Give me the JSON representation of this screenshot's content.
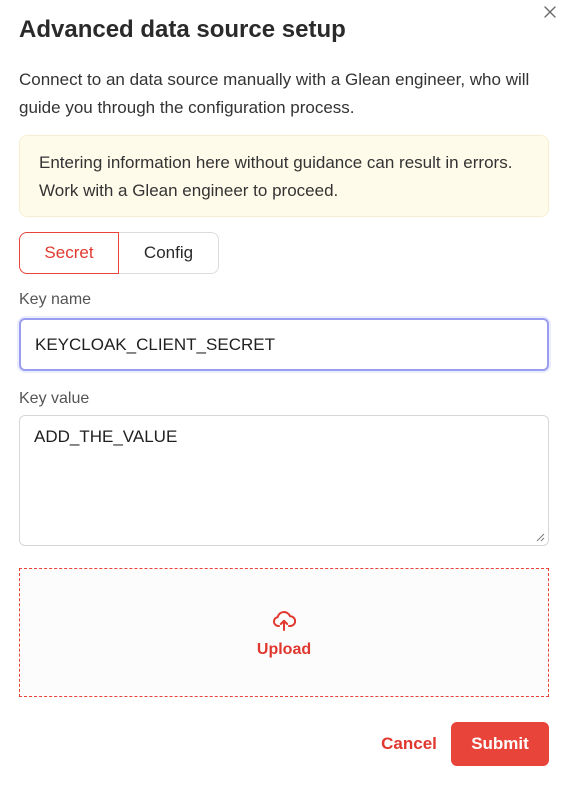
{
  "dialog": {
    "title": "Advanced data source setup",
    "subtitle": "Connect to an data source manually with a Glean engineer, who will guide you through the configuration process.",
    "close_icon": "close-icon"
  },
  "warning": {
    "text": "Entering information here without guidance can result in errors. Work with a Glean engineer to proceed."
  },
  "tabs": [
    {
      "label": "Secret",
      "active": true
    },
    {
      "label": "Config",
      "active": false
    }
  ],
  "form": {
    "key_name_label": "Key name",
    "key_name_value": "KEYCLOAK_CLIENT_SECRET",
    "key_value_label": "Key value",
    "key_value_value": "ADD_THE_VALUE"
  },
  "upload": {
    "icon": "cloud-upload-icon",
    "label": "Upload"
  },
  "actions": {
    "cancel_label": "Cancel",
    "submit_label": "Submit"
  },
  "colors": {
    "accent": "#e8443a",
    "warning_bg": "#fffbea",
    "focus_border": "#9a9ef0"
  }
}
